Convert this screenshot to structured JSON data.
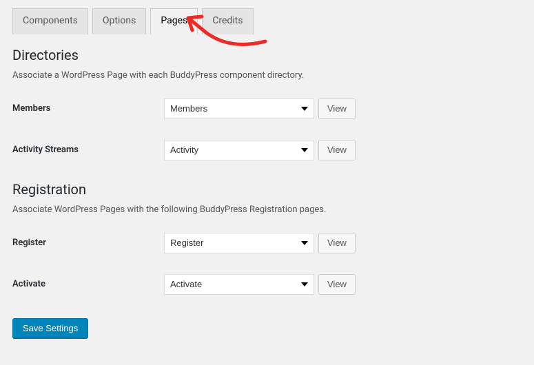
{
  "tabs": {
    "components": "Components",
    "options": "Options",
    "pages": "Pages",
    "credits": "Credits"
  },
  "directories": {
    "title": "Directories",
    "desc": "Associate a WordPress Page with each BuddyPress component directory.",
    "rows": {
      "members": {
        "label": "Members",
        "value": "Members",
        "view": "View"
      },
      "activity": {
        "label": "Activity Streams",
        "value": "Activity",
        "view": "View"
      }
    }
  },
  "registration": {
    "title": "Registration",
    "desc": "Associate WordPress Pages with the following BuddyPress Registration pages.",
    "rows": {
      "register": {
        "label": "Register",
        "value": "Register",
        "view": "View"
      },
      "activate": {
        "label": "Activate",
        "value": "Activate",
        "view": "View"
      }
    }
  },
  "buttons": {
    "save": "Save Settings"
  }
}
